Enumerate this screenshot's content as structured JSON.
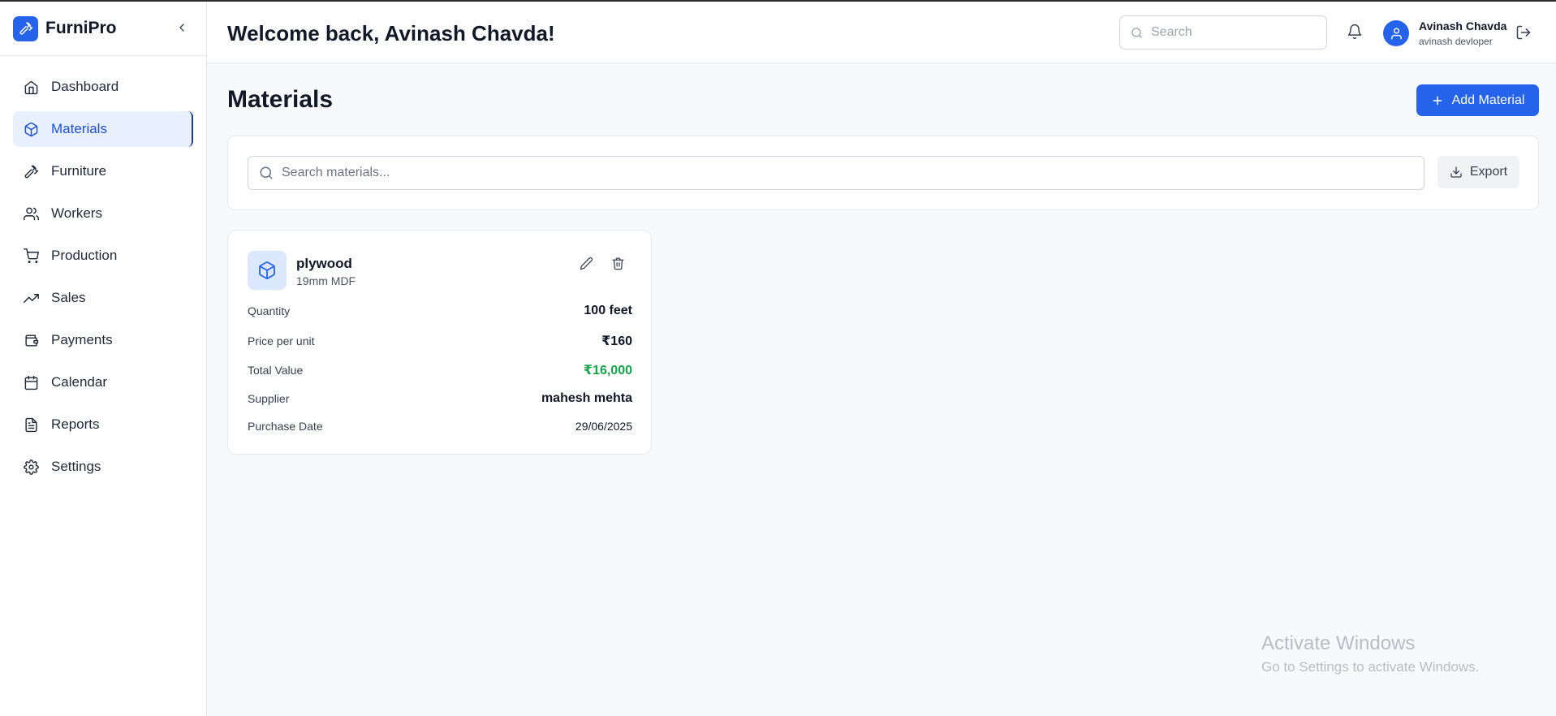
{
  "brand": {
    "name": "FurniPro"
  },
  "sidebar": {
    "items": [
      {
        "label": "Dashboard",
        "icon": "home-icon",
        "active": false
      },
      {
        "label": "Materials",
        "icon": "package-icon",
        "active": true
      },
      {
        "label": "Furniture",
        "icon": "hammer-icon",
        "active": false
      },
      {
        "label": "Workers",
        "icon": "users-icon",
        "active": false
      },
      {
        "label": "Production",
        "icon": "cart-icon",
        "active": false
      },
      {
        "label": "Sales",
        "icon": "trending-up-icon",
        "active": false
      },
      {
        "label": "Payments",
        "icon": "wallet-icon",
        "active": false
      },
      {
        "label": "Calendar",
        "icon": "calendar-icon",
        "active": false
      },
      {
        "label": "Reports",
        "icon": "file-text-icon",
        "active": false
      },
      {
        "label": "Settings",
        "icon": "gear-icon",
        "active": false
      }
    ]
  },
  "header": {
    "welcome": "Welcome back, Avinash Chavda!",
    "search_placeholder": "Search",
    "user": {
      "name": "Avinash Chavda",
      "role": "avinash devloper"
    }
  },
  "main": {
    "title": "Materials",
    "add_button": "Add Material",
    "search_placeholder": "Search materials...",
    "export_button": "Export"
  },
  "materials": [
    {
      "name": "plywood",
      "type": "19mm MDF",
      "fields": [
        {
          "label": "Quantity",
          "value": "100 feet"
        },
        {
          "label": "Price per unit",
          "value": "₹160"
        },
        {
          "label": "Total Value",
          "value": "₹16,000"
        },
        {
          "label": "Supplier",
          "value": "mahesh mehta"
        },
        {
          "label": "Purchase Date",
          "value": "29/06/2025"
        }
      ]
    }
  ],
  "watermark": {
    "title": "Activate Windows",
    "subtitle": "Go to Settings to activate Windows."
  },
  "colors": {
    "accent": "#2563eb",
    "active_bg": "#e8f0fe",
    "total_value": "#16a34a"
  }
}
